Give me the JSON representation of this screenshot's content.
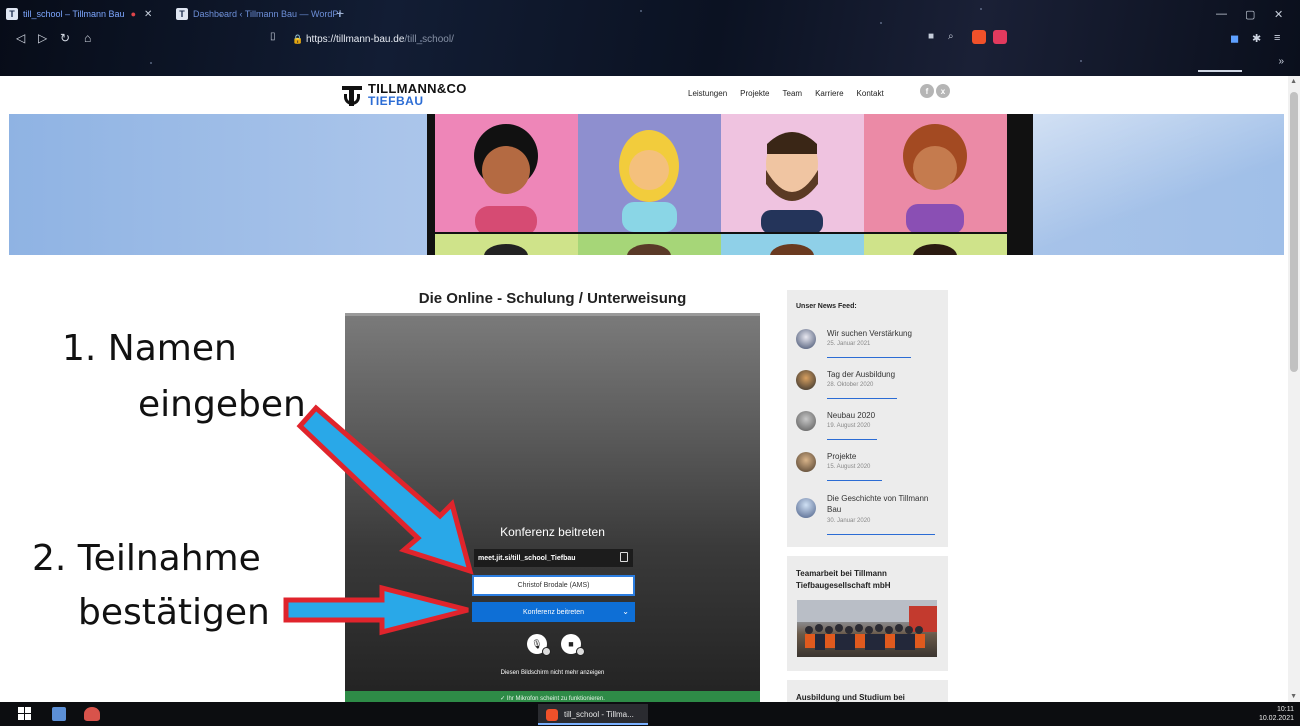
{
  "browser": {
    "tabs": [
      {
        "title": "till_school – Tillmann Bau",
        "active": true
      },
      {
        "title": "Dashboard ‹ Tillmann Bau — WordPr",
        "active": false
      }
    ],
    "url": {
      "host": "https://tillmann-bau.de",
      "path": "/till_school/"
    }
  },
  "site": {
    "logo": {
      "line1": "TILLMANN&CO",
      "line2": "TIEFBAU"
    },
    "menu": [
      "Leistungen",
      "Projekte",
      "Team",
      "Karriere",
      "Kontakt"
    ],
    "social": {
      "facebook": "f",
      "xing": "x"
    },
    "section_title": "Die Online - Schulung / Unterweisung"
  },
  "meeting": {
    "title": "Konferenz beitreten",
    "room": "meet.jit.si/till_school_Tiefbau",
    "name_value": "Christof Brodale (AMS)",
    "join_label": "Konferenz beitreten",
    "dont_show": "Diesen Bildschirm nicht mehr anzeigen",
    "mic_status": "✓  Ihr Mikrofon scheint zu funktionieren."
  },
  "annotations": {
    "step1_line1": "1. Namen",
    "step1_line2": "eingeben",
    "step2_line1": "2. Teilnahme",
    "step2_line2": "bestätigen"
  },
  "sidebar": {
    "news_heading": "Unser News Feed:",
    "news": [
      {
        "title": "Wir suchen Verstärkung",
        "date": "25. Januar 2021"
      },
      {
        "title": "Tag der Ausbildung",
        "date": "28. Oktober 2020"
      },
      {
        "title": "Neubau 2020",
        "date": "19. August 2020"
      },
      {
        "title": "Projekte",
        "date": "15. August 2020"
      },
      {
        "title": "Die Geschichte von Tillmann Bau",
        "date": "30. Januar 2020"
      }
    ],
    "card2_title": "Teamarbeit bei Tillmann Tiefbaugesellschaft mbH",
    "card3_title": "Ausbildung und Studium bei Tillmann"
  },
  "taskbar": {
    "app_label": "till_school - Tillma...",
    "time": "10:11",
    "date": "10.02.2021"
  },
  "colors": {
    "accent": "#2b6cd4",
    "join_button": "#0e6fd6",
    "mic_ok": "#2e8b47",
    "arrow_fill": "#29a8e8",
    "arrow_stroke": "#e0242c"
  }
}
